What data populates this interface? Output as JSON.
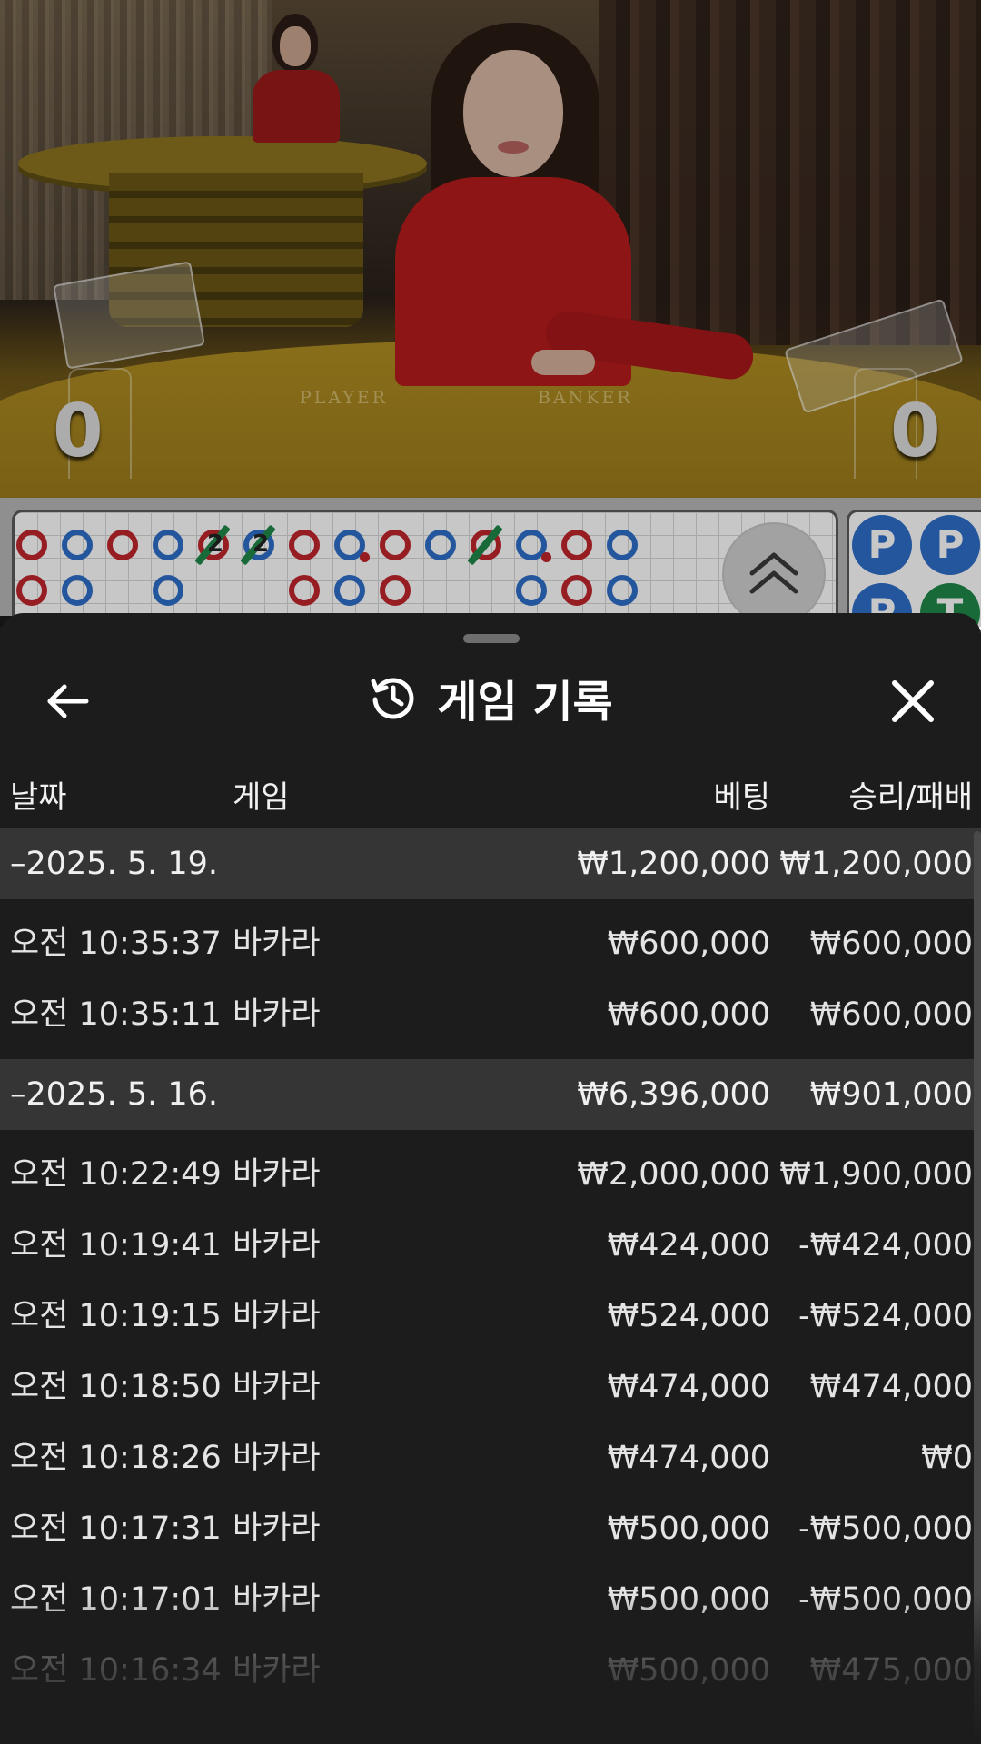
{
  "video": {
    "player_score": "0",
    "banker_score": "0",
    "table_labels": [
      "PLAYER",
      "BANKER"
    ]
  },
  "roadmap": {
    "side_road": [
      "P",
      "P",
      "P",
      "T"
    ]
  },
  "sheet": {
    "title": "게임 기록",
    "columns": {
      "date": "날짜",
      "game": "게임",
      "bet": "베팅",
      "win_loss": "승리/패배"
    },
    "groups": [
      {
        "date": "–2025. 5. 19.",
        "bet_total": "₩1,200,000",
        "win_total": "₩1,200,000",
        "rows": [
          {
            "time": "오전 10:35:37",
            "game": "바카라",
            "bet": "₩600,000",
            "win": "₩600,000"
          },
          {
            "time": "오전 10:35:11",
            "game": "바카라",
            "bet": "₩600,000",
            "win": "₩600,000"
          }
        ]
      },
      {
        "date": "–2025. 5. 16.",
        "bet_total": "₩6,396,000",
        "win_total": "₩901,000",
        "rows": [
          {
            "time": "오전 10:22:49",
            "game": "바카라",
            "bet": "₩2,000,000",
            "win": "₩1,900,000"
          },
          {
            "time": "오전 10:19:41",
            "game": "바카라",
            "bet": "₩424,000",
            "win": "-₩424,000"
          },
          {
            "time": "오전 10:19:15",
            "game": "바카라",
            "bet": "₩524,000",
            "win": "-₩524,000"
          },
          {
            "time": "오전 10:18:50",
            "game": "바카라",
            "bet": "₩474,000",
            "win": "₩474,000"
          },
          {
            "time": "오전 10:18:26",
            "game": "바카라",
            "bet": "₩474,000",
            "win": "₩0"
          },
          {
            "time": "오전 10:17:31",
            "game": "바카라",
            "bet": "₩500,000",
            "win": "-₩500,000"
          },
          {
            "time": "오전 10:17:01",
            "game": "바카라",
            "bet": "₩500,000",
            "win": "-₩500,000"
          },
          {
            "time": "오전 10:16:34",
            "game": "바카라",
            "bet": "₩500,000",
            "win": "₩475,000"
          }
        ]
      }
    ]
  },
  "colors": {
    "banker_red": "#c0262c",
    "player_blue": "#2f6fc9",
    "tie_green": "#1f8a4a",
    "sheet_bg": "#1c1c1c",
    "group_row_bg": "#353535"
  },
  "icons": [
    "back-arrow-icon",
    "history-icon",
    "close-icon",
    "chevron-double-up-icon"
  ]
}
